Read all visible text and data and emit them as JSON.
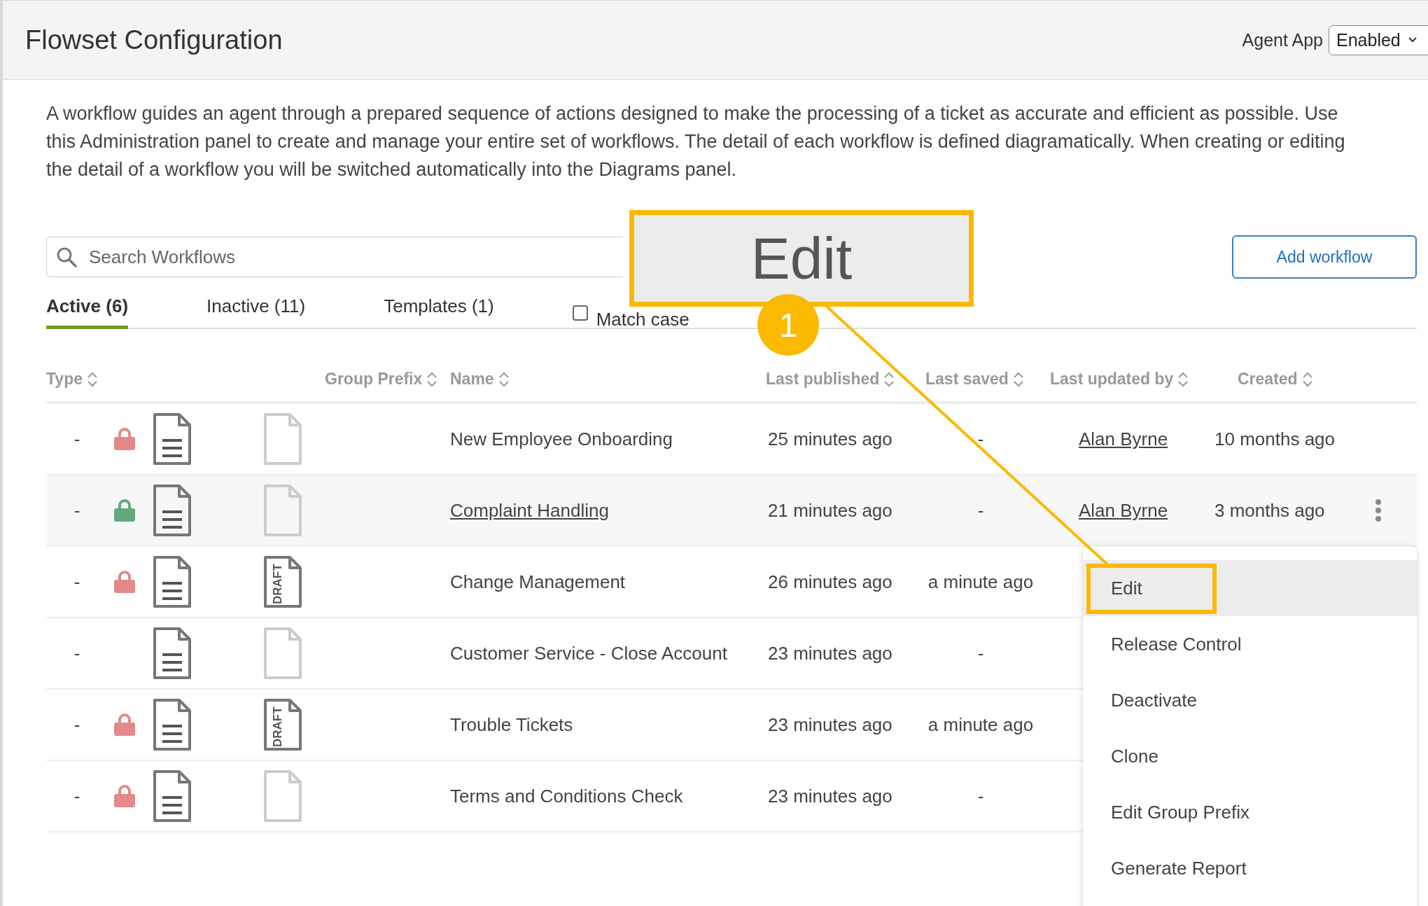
{
  "header": {
    "title": "Flowset Configuration",
    "agent_app": {
      "label": "Agent App",
      "value": "Enabled"
    }
  },
  "description": "A workflow guides an agent through a prepared sequence of actions designed to make the processing of a ticket as accurate and efficient as possible. Use this Administration panel to create and manage your entire set of workflows. The detail of each workflow is defined diagramatically. When creating or editing the detail of a workflow you will be switched automatically into the Diagrams panel.",
  "search": {
    "placeholder": "Search Workflows"
  },
  "add_button": "Add workflow",
  "tabs": [
    {
      "label": "Active (6)",
      "selected": true
    },
    {
      "label": "Inactive (11)",
      "selected": false
    },
    {
      "label": "Templates (1)",
      "selected": false
    }
  ],
  "match_case": {
    "label": "Match case",
    "checked": false
  },
  "table": {
    "columns": [
      "Type",
      "Group Prefix",
      "Name",
      "Last published",
      "Last saved",
      "Last updated by",
      "Created"
    ],
    "rows": [
      {
        "type": "-",
        "lock": {
          "color": "#e28a8a"
        },
        "status_icon": {
          "kind": "blank"
        },
        "name": "New Employee Onboarding",
        "last_published": "25 minutes ago",
        "last_saved": "-",
        "last_updated_by": "Alan Byrne",
        "created": "10 months ago",
        "selected": false
      },
      {
        "type": "-",
        "lock": {
          "color": "#63a97c"
        },
        "status_icon": {
          "kind": "blank"
        },
        "name": "Complaint Handling",
        "last_published": "21 minutes ago",
        "last_saved": "-",
        "last_updated_by": "Alan Byrne",
        "created": "3 months ago",
        "selected": true
      },
      {
        "type": "-",
        "lock": {
          "color": "#e28a8a"
        },
        "status_icon": {
          "kind": "draft",
          "label": "DRAFT"
        },
        "name": "Change Management",
        "last_published": "26 minutes ago",
        "last_saved": "a minute ago",
        "selected": false
      },
      {
        "type": "-",
        "status_icon": {
          "kind": "blank"
        },
        "name": "Customer Service - Close Account",
        "last_published": "23 minutes ago",
        "last_saved": "-",
        "selected": false
      },
      {
        "type": "-",
        "lock": {
          "color": "#e28a8a"
        },
        "status_icon": {
          "kind": "draft",
          "label": "DRAFT"
        },
        "name": "Trouble Tickets",
        "last_published": "23 minutes ago",
        "last_saved": "a minute ago",
        "selected": false
      },
      {
        "type": "-",
        "lock": {
          "color": "#e28a8a"
        },
        "status_icon": {
          "kind": "blank"
        },
        "name": "Terms and Conditions Check",
        "last_published": "23 minutes ago",
        "last_saved": "-",
        "selected": false
      }
    ]
  },
  "context_menu": {
    "items": [
      {
        "label": "Edit",
        "selected": true
      },
      {
        "label": "Release Control",
        "selected": false
      },
      {
        "label": "Deactivate",
        "selected": false
      },
      {
        "label": "Clone",
        "selected": false
      },
      {
        "label": "Edit Group Prefix",
        "selected": false
      },
      {
        "label": "Generate Report",
        "selected": false
      }
    ]
  },
  "annotation": {
    "callout": "Edit",
    "step": "1"
  }
}
